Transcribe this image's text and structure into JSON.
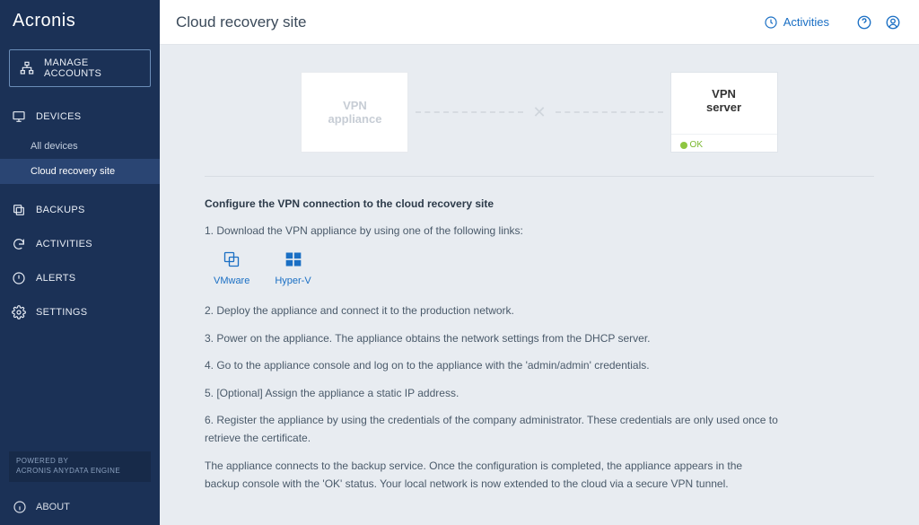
{
  "brand": "Acronis",
  "header": {
    "title": "Cloud recovery site",
    "activities": "Activities"
  },
  "sidebar": {
    "manage_accounts": "MANAGE ACCOUNTS",
    "devices": "DEVICES",
    "sub_all_devices": "All devices",
    "sub_cloud_recovery": "Cloud recovery site",
    "backups": "BACKUPS",
    "activities": "ACTIVITIES",
    "alerts": "ALERTS",
    "settings": "SETTINGS",
    "powered_line1": "POWERED BY",
    "powered_line2": "ACRONIS ANYDATA ENGINE",
    "about": "ABOUT"
  },
  "diagram": {
    "vpn_appliance_l1": "VPN",
    "vpn_appliance_l2": "appliance",
    "vpn_server_l1": "VPN",
    "vpn_server_l2": "server",
    "server_status": "OK"
  },
  "instructions": {
    "lead": "Configure the VPN connection to the cloud recovery site",
    "step1": "1. Download the VPN appliance by using one of the following links:",
    "dl_vmware": "VMware",
    "dl_hyperv": "Hyper-V",
    "step2": "2. Deploy the appliance and connect it to the production network.",
    "step3": "3. Power on the appliance. The appliance obtains the network settings from the DHCP server.",
    "step4": "4. Go to the appliance console and log on to the appliance with the 'admin/admin' credentials.",
    "step5": "5. [Optional] Assign the appliance a static IP address.",
    "step6": "6. Register the appliance by using the credentials of the company administrator. These credentials are only used once to retrieve the certificate.",
    "footer": "The appliance connects to the backup service. Once the configuration is completed, the appliance appears in the backup console with the 'OK' status. Your local network is now extended to the cloud via a secure VPN tunnel."
  }
}
